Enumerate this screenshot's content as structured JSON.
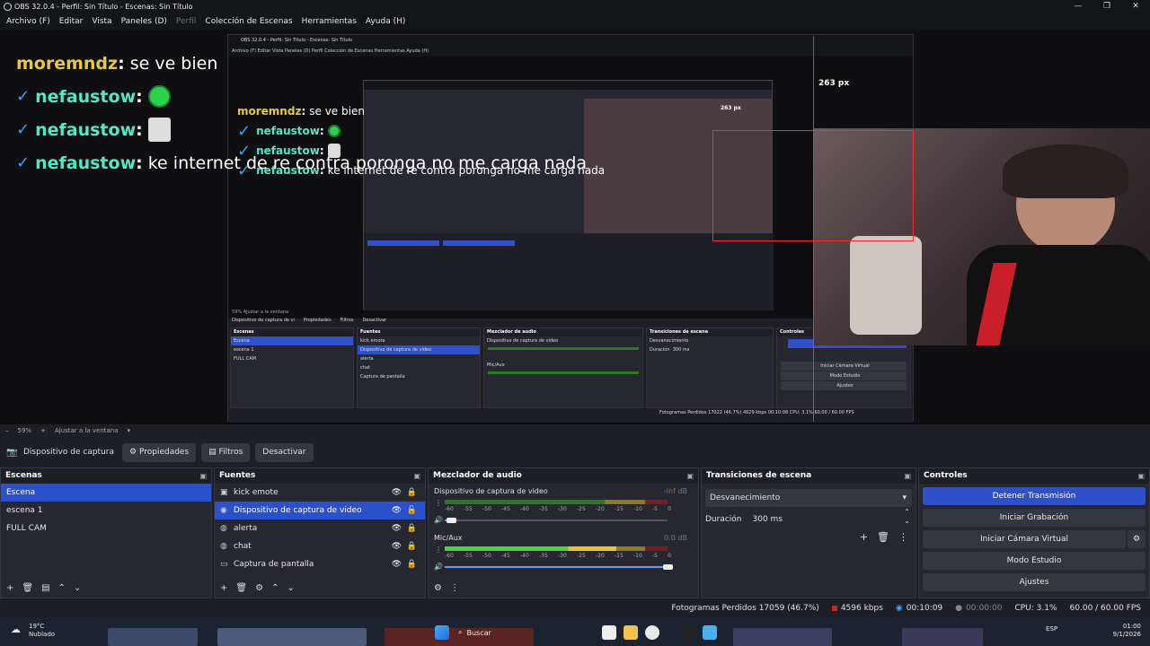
{
  "window": {
    "title": "OBS 32.0.4 - Perfil: Sin Título - Escenas: Sin Título"
  },
  "menu": [
    "Archivo (F)",
    "Editar",
    "Vista",
    "Paneles (D)",
    "Perfil",
    "Colección de Escenas",
    "Herramientas",
    "Ayuda (H)"
  ],
  "chat": {
    "lines": [
      {
        "user": "moremndz",
        "sep": ":",
        "text": "se ve bien"
      },
      {
        "user": "nefaustow",
        "sep": ":",
        "text": "",
        "emote": "green-emote"
      },
      {
        "user": "nefaustow",
        "sep": ":",
        "text": "",
        "emote": "face-emote"
      },
      {
        "user": "nefaustow",
        "sep": ":",
        "text": "ke internet de re contra poronga no me carga nada"
      }
    ]
  },
  "nested": {
    "title": "OBS 32.0.4 - Perfil: Sin Título - Escenas: Sin Título",
    "menu": "Archivo (F)   Editar   Vista   Paneles (D)   Perfil   Colección de Escenas   Herramientas   Ayuda (H)",
    "px_label": "263 px",
    "small_px": "263 px",
    "scenes_header": "Escenas",
    "sources_header": "Fuentes",
    "mixer_header": "Mezclador de audio",
    "transitions_header": "Transiciones de escena",
    "controls_header": "Controles",
    "scenes": [
      "Escena",
      "escena 1",
      "FULL CAM"
    ],
    "sources": [
      "kick emote",
      "Dispositivo de captura de video",
      "alerta",
      "chat",
      "Captura de pantalla"
    ],
    "mix1": "Dispositivo de captura de video",
    "mix2": "Mic/Aux",
    "trans": "Desvanecimiento",
    "dur_label": "Duración",
    "dur": "300 ms",
    "ctl": [
      "Iniciar Cámara Virtual",
      "Modo Estudio",
      "Ajustes"
    ],
    "status": "Fotogramas Perdidos 17022 (46.7%)     4629 kbps    00:10:08    CPU: 3.1%   60.00 / 60.00 FPS",
    "zoom": "59%   Ajustar a la ventana",
    "srcbar": [
      "Dispositivo de captura de vi",
      "Propiedades",
      "Filtros",
      "Desactivar"
    ]
  },
  "zoombar": {
    "minus": "–",
    "zoom": "59%",
    "plus": "+",
    "fit": "Ajustar a la ventana"
  },
  "sourcebar": {
    "name": "Dispositivo de captura de v",
    "properties": "Propiedades",
    "filters": "Filtros",
    "deactivate": "Desactivar"
  },
  "scenes": {
    "header": "Escenas",
    "items": [
      "Escena",
      "escena 1",
      "FULL CAM"
    ],
    "selected": 0
  },
  "sources": {
    "header": "Fuentes",
    "items": [
      {
        "label": "kick emote",
        "icon": "image-icon"
      },
      {
        "label": "Dispositivo de captura de video",
        "icon": "camera-icon"
      },
      {
        "label": "alerta",
        "icon": "globe-icon"
      },
      {
        "label": "chat",
        "icon": "globe-icon"
      },
      {
        "label": "Captura de pantalla",
        "icon": "monitor-icon"
      }
    ],
    "selected": 1
  },
  "mixer": {
    "header": "Mezclador de audio",
    "channels": [
      {
        "name": "Dispositivo de captura de video",
        "db": "-inf dB",
        "level": 0.0,
        "volume": 0.03
      },
      {
        "name": "Mic/Aux",
        "db": "0.0 dB",
        "level": 0.77,
        "volume": 1.0
      }
    ],
    "scale": [
      "-60",
      "-55",
      "-50",
      "-45",
      "-40",
      "-35",
      "-30",
      "-25",
      "-20",
      "-15",
      "-10",
      "-5",
      "0"
    ]
  },
  "transitions": {
    "header": "Transiciones de escena",
    "selected": "Desvanecimiento",
    "duration_label": "Duración",
    "duration": "300 ms"
  },
  "controls": {
    "header": "Controles",
    "stop_stream": "Detener Transmisión",
    "start_record": "Iniciar Grabación",
    "virtual_cam": "Iniciar Cámara Virtual",
    "studio_mode": "Modo Estudio",
    "settings": "Ajustes"
  },
  "status": {
    "dropped": "Fotogramas Perdidos 17059 (46.7%)",
    "bitrate": "4596 kbps",
    "stream_time": "00:10:09",
    "rec_time": "00:00:00",
    "cpu": "CPU: 3.1%",
    "fps": "60.00 / 60.00 FPS"
  },
  "taskbar": {
    "temp": "19°C",
    "weather": "Nublado",
    "search": "Buscar",
    "lang": "ESP",
    "time": "01:00",
    "date": "9/1/2026"
  }
}
